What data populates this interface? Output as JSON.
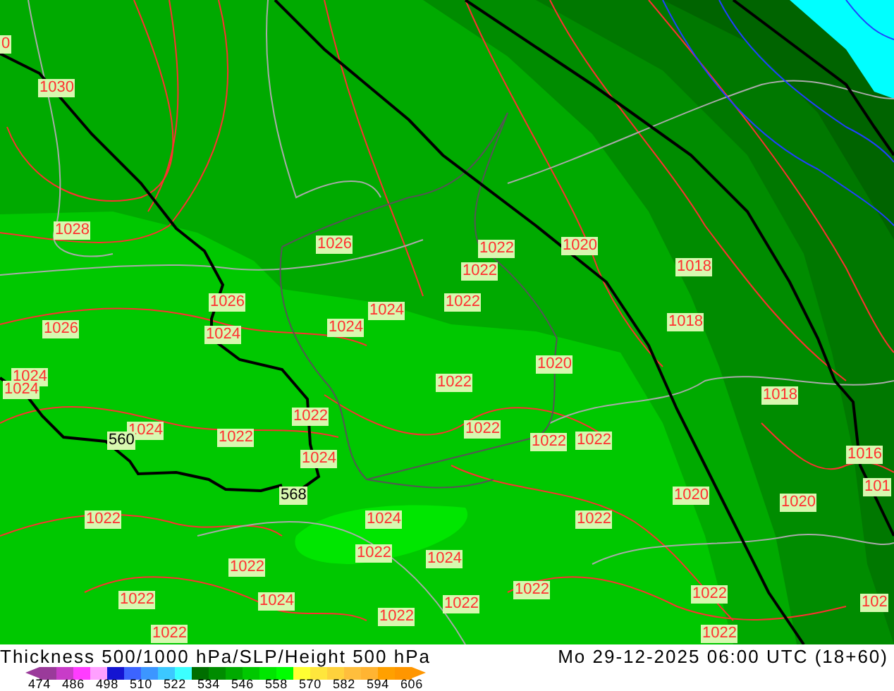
{
  "map": {
    "labels": [
      {
        "text": "0",
        "kind": "isobar"
      },
      {
        "text": "1030",
        "kind": "isobar"
      },
      {
        "text": "1028",
        "kind": "isobar"
      },
      {
        "text": "1026",
        "kind": "isobar"
      },
      {
        "text": "1022",
        "kind": "isobar"
      },
      {
        "text": "1020",
        "kind": "isobar"
      },
      {
        "text": "1022",
        "kind": "isobar"
      },
      {
        "text": "1018",
        "kind": "isobar"
      },
      {
        "text": "1026",
        "kind": "isobar"
      },
      {
        "text": "1022",
        "kind": "isobar"
      },
      {
        "text": "1024",
        "kind": "isobar"
      },
      {
        "text": "1018",
        "kind": "isobar"
      },
      {
        "text": "1026",
        "kind": "isobar"
      },
      {
        "text": "1024",
        "kind": "isobar"
      },
      {
        "text": "1024",
        "kind": "isobar"
      },
      {
        "text": "1020",
        "kind": "isobar"
      },
      {
        "text": "1022",
        "kind": "isobar"
      },
      {
        "text": "1024",
        "kind": "isobar"
      },
      {
        "text": "1024",
        "kind": "isobar"
      },
      {
        "text": "1018",
        "kind": "isobar"
      },
      {
        "text": "1024",
        "kind": "isobar"
      },
      {
        "text": "560",
        "kind": "height"
      },
      {
        "text": "1022",
        "kind": "isobar"
      },
      {
        "text": "1022",
        "kind": "isobar"
      },
      {
        "text": "1022",
        "kind": "isobar"
      },
      {
        "text": "1022",
        "kind": "isobar"
      },
      {
        "text": "1022",
        "kind": "isobar"
      },
      {
        "text": "1016",
        "kind": "isobar"
      },
      {
        "text": "1024",
        "kind": "isobar"
      },
      {
        "text": "101",
        "kind": "isobar"
      },
      {
        "text": "568",
        "kind": "height"
      },
      {
        "text": "1020",
        "kind": "isobar"
      },
      {
        "text": "1022",
        "kind": "isobar"
      },
      {
        "text": "1020",
        "kind": "isobar"
      },
      {
        "text": "1024",
        "kind": "isobar"
      },
      {
        "text": "1022",
        "kind": "isobar"
      },
      {
        "text": "1022",
        "kind": "isobar"
      },
      {
        "text": "1024",
        "kind": "isobar"
      },
      {
        "text": "1022",
        "kind": "isobar"
      },
      {
        "text": "1022",
        "kind": "isobar"
      },
      {
        "text": "1022",
        "kind": "isobar"
      },
      {
        "text": "1022",
        "kind": "isobar"
      },
      {
        "text": "1022",
        "kind": "isobar"
      },
      {
        "text": "1024",
        "kind": "isobar"
      },
      {
        "text": "1022",
        "kind": "isobar"
      },
      {
        "text": "102",
        "kind": "isobar"
      },
      {
        "text": "1022",
        "kind": "isobar"
      },
      {
        "text": "1022",
        "kind": "isobar"
      }
    ]
  },
  "footer": {
    "title": "Thickness 500/1000 hPa/SLP/Height 500 hPa",
    "datetime": "Mo 29-12-2025 06:00 UTC (18+60)",
    "legend": {
      "cells": [
        {
          "color": "#9a3a9a"
        },
        {
          "color": "#c83cc8"
        },
        {
          "color": "#ff3cff"
        },
        {
          "color": "#ffa0ff"
        },
        {
          "color": "#1414d2"
        },
        {
          "color": "#3c64ff"
        },
        {
          "color": "#3c96ff"
        },
        {
          "color": "#3cc8ff"
        },
        {
          "color": "#3cffff"
        },
        {
          "color": "#006e00"
        },
        {
          "color": "#008c00"
        },
        {
          "color": "#00aa00"
        },
        {
          "color": "#00c800"
        },
        {
          "color": "#00e600"
        },
        {
          "color": "#00ff00"
        },
        {
          "color": "#ffff32"
        },
        {
          "color": "#ffe63c"
        },
        {
          "color": "#ffd23c"
        },
        {
          "color": "#ffbe3c"
        },
        {
          "color": "#ffb432"
        },
        {
          "color": "#ffa000"
        },
        {
          "color": "#ff9600"
        }
      ],
      "ticks": [
        "474",
        "486",
        "498",
        "510",
        "522",
        "534",
        "546",
        "558",
        "570",
        "582",
        "594",
        "606"
      ]
    }
  }
}
